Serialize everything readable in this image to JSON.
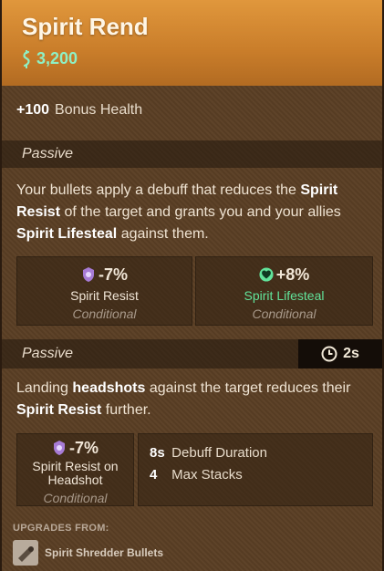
{
  "item": {
    "title": "Spirit Rend",
    "cost": "3,200"
  },
  "bonus": {
    "value": "+100",
    "label": "Bonus Health"
  },
  "passive1": {
    "label": "Passive",
    "desc_parts": [
      "Your bullets apply a debuff that reduces the ",
      "Spirit Resist",
      " of the target and grants you and your allies ",
      "Spirit Lifesteal",
      " against them."
    ],
    "stats": [
      {
        "value": "-7%",
        "name": "Spirit Resist",
        "condition": "Conditional",
        "icon": "spirit-resist-icon"
      },
      {
        "value": "+8%",
        "name": "Spirit Lifesteal",
        "condition": "Conditional",
        "icon": "spirit-lifesteal-icon"
      }
    ]
  },
  "passive2": {
    "label": "Passive",
    "cooldown": "2s",
    "desc_parts": [
      "Landing ",
      "headshots",
      " against the target reduces their ",
      "Spirit Resist",
      " further."
    ],
    "stat": {
      "value": "-7%",
      "name": "Spirit Resist on Headshot",
      "condition": "Conditional",
      "icon": "spirit-resist-icon"
    },
    "props": [
      {
        "value": "8s",
        "label": "Debuff Duration"
      },
      {
        "value": "4",
        "label": "Max Stacks"
      }
    ]
  },
  "upgrades": {
    "label": "UPGRADES FROM:",
    "item_name": "Spirit Shredder Bullets"
  },
  "colors": {
    "header": "#e0973c",
    "souls": "#8ef0c4",
    "spirit": "#a77bd6",
    "lifesteal": "#61e39a"
  }
}
